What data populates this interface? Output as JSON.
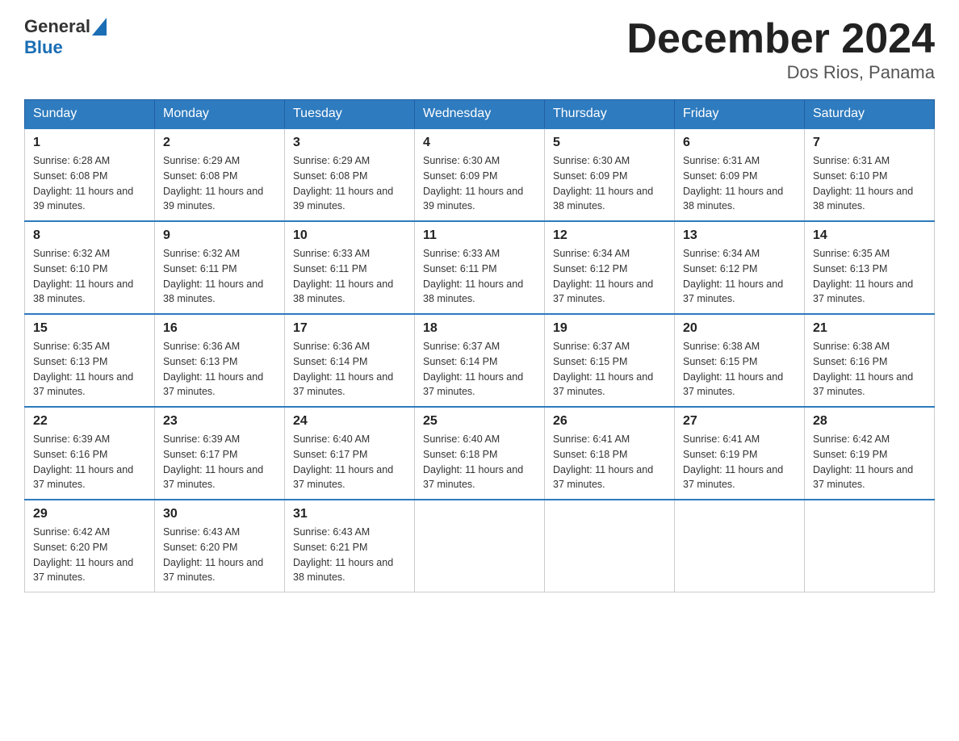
{
  "header": {
    "logo_general": "General",
    "logo_blue": "Blue",
    "month_title": "December 2024",
    "location": "Dos Rios, Panama"
  },
  "columns": [
    "Sunday",
    "Monday",
    "Tuesday",
    "Wednesday",
    "Thursday",
    "Friday",
    "Saturday"
  ],
  "weeks": [
    [
      {
        "day": "1",
        "sunrise": "6:28 AM",
        "sunset": "6:08 PM",
        "daylight": "11 hours and 39 minutes."
      },
      {
        "day": "2",
        "sunrise": "6:29 AM",
        "sunset": "6:08 PM",
        "daylight": "11 hours and 39 minutes."
      },
      {
        "day": "3",
        "sunrise": "6:29 AM",
        "sunset": "6:08 PM",
        "daylight": "11 hours and 39 minutes."
      },
      {
        "day": "4",
        "sunrise": "6:30 AM",
        "sunset": "6:09 PM",
        "daylight": "11 hours and 39 minutes."
      },
      {
        "day": "5",
        "sunrise": "6:30 AM",
        "sunset": "6:09 PM",
        "daylight": "11 hours and 38 minutes."
      },
      {
        "day": "6",
        "sunrise": "6:31 AM",
        "sunset": "6:09 PM",
        "daylight": "11 hours and 38 minutes."
      },
      {
        "day": "7",
        "sunrise": "6:31 AM",
        "sunset": "6:10 PM",
        "daylight": "11 hours and 38 minutes."
      }
    ],
    [
      {
        "day": "8",
        "sunrise": "6:32 AM",
        "sunset": "6:10 PM",
        "daylight": "11 hours and 38 minutes."
      },
      {
        "day": "9",
        "sunrise": "6:32 AM",
        "sunset": "6:11 PM",
        "daylight": "11 hours and 38 minutes."
      },
      {
        "day": "10",
        "sunrise": "6:33 AM",
        "sunset": "6:11 PM",
        "daylight": "11 hours and 38 minutes."
      },
      {
        "day": "11",
        "sunrise": "6:33 AM",
        "sunset": "6:11 PM",
        "daylight": "11 hours and 38 minutes."
      },
      {
        "day": "12",
        "sunrise": "6:34 AM",
        "sunset": "6:12 PM",
        "daylight": "11 hours and 37 minutes."
      },
      {
        "day": "13",
        "sunrise": "6:34 AM",
        "sunset": "6:12 PM",
        "daylight": "11 hours and 37 minutes."
      },
      {
        "day": "14",
        "sunrise": "6:35 AM",
        "sunset": "6:13 PM",
        "daylight": "11 hours and 37 minutes."
      }
    ],
    [
      {
        "day": "15",
        "sunrise": "6:35 AM",
        "sunset": "6:13 PM",
        "daylight": "11 hours and 37 minutes."
      },
      {
        "day": "16",
        "sunrise": "6:36 AM",
        "sunset": "6:13 PM",
        "daylight": "11 hours and 37 minutes."
      },
      {
        "day": "17",
        "sunrise": "6:36 AM",
        "sunset": "6:14 PM",
        "daylight": "11 hours and 37 minutes."
      },
      {
        "day": "18",
        "sunrise": "6:37 AM",
        "sunset": "6:14 PM",
        "daylight": "11 hours and 37 minutes."
      },
      {
        "day": "19",
        "sunrise": "6:37 AM",
        "sunset": "6:15 PM",
        "daylight": "11 hours and 37 minutes."
      },
      {
        "day": "20",
        "sunrise": "6:38 AM",
        "sunset": "6:15 PM",
        "daylight": "11 hours and 37 minutes."
      },
      {
        "day": "21",
        "sunrise": "6:38 AM",
        "sunset": "6:16 PM",
        "daylight": "11 hours and 37 minutes."
      }
    ],
    [
      {
        "day": "22",
        "sunrise": "6:39 AM",
        "sunset": "6:16 PM",
        "daylight": "11 hours and 37 minutes."
      },
      {
        "day": "23",
        "sunrise": "6:39 AM",
        "sunset": "6:17 PM",
        "daylight": "11 hours and 37 minutes."
      },
      {
        "day": "24",
        "sunrise": "6:40 AM",
        "sunset": "6:17 PM",
        "daylight": "11 hours and 37 minutes."
      },
      {
        "day": "25",
        "sunrise": "6:40 AM",
        "sunset": "6:18 PM",
        "daylight": "11 hours and 37 minutes."
      },
      {
        "day": "26",
        "sunrise": "6:41 AM",
        "sunset": "6:18 PM",
        "daylight": "11 hours and 37 minutes."
      },
      {
        "day": "27",
        "sunrise": "6:41 AM",
        "sunset": "6:19 PM",
        "daylight": "11 hours and 37 minutes."
      },
      {
        "day": "28",
        "sunrise": "6:42 AM",
        "sunset": "6:19 PM",
        "daylight": "11 hours and 37 minutes."
      }
    ],
    [
      {
        "day": "29",
        "sunrise": "6:42 AM",
        "sunset": "6:20 PM",
        "daylight": "11 hours and 37 minutes."
      },
      {
        "day": "30",
        "sunrise": "6:43 AM",
        "sunset": "6:20 PM",
        "daylight": "11 hours and 37 minutes."
      },
      {
        "day": "31",
        "sunrise": "6:43 AM",
        "sunset": "6:21 PM",
        "daylight": "11 hours and 38 minutes."
      },
      null,
      null,
      null,
      null
    ]
  ]
}
